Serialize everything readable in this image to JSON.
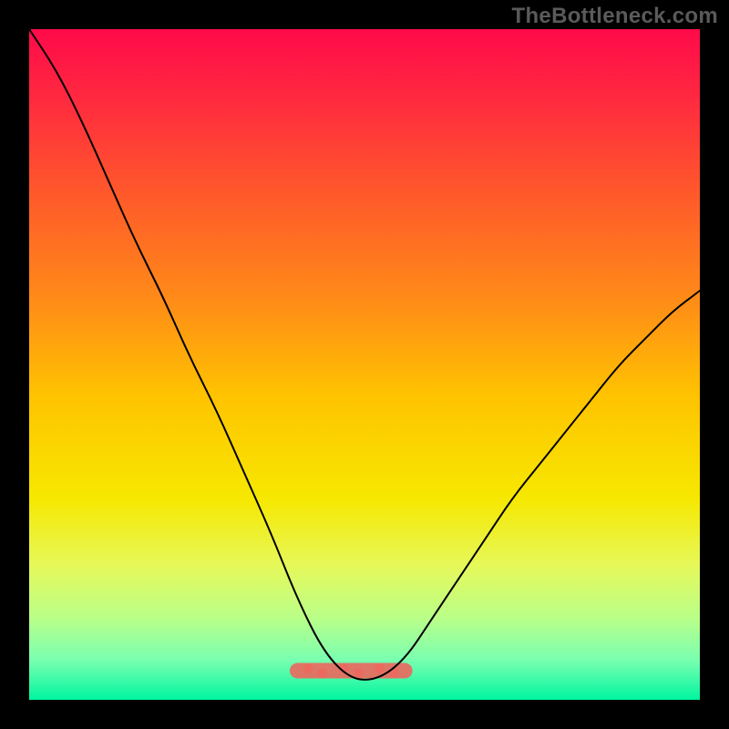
{
  "watermark": "TheBottleneck.com",
  "background": {
    "outer": "#000000",
    "gradient_stops": [
      {
        "offset": 0.0,
        "color": "#ff0a4a"
      },
      {
        "offset": 0.1,
        "color": "#ff2840"
      },
      {
        "offset": 0.25,
        "color": "#ff5a2a"
      },
      {
        "offset": 0.4,
        "color": "#ff8a18"
      },
      {
        "offset": 0.55,
        "color": "#ffc400"
      },
      {
        "offset": 0.7,
        "color": "#f6e800"
      },
      {
        "offset": 0.8,
        "color": "#e6f85a"
      },
      {
        "offset": 0.88,
        "color": "#b8ff8a"
      },
      {
        "offset": 0.94,
        "color": "#7affb0"
      },
      {
        "offset": 1.0,
        "color": "#00f5a0"
      }
    ]
  },
  "accent_band": {
    "color": "#ea6a60",
    "x_start": 0.4,
    "x_end": 0.56,
    "y_top": 0.945,
    "y_bottom": 0.968
  },
  "chart_data": {
    "type": "line",
    "title": "",
    "xlabel": "",
    "ylabel": "",
    "xlim": [
      0,
      1
    ],
    "ylim": [
      0,
      1
    ],
    "series": [
      {
        "name": "curve",
        "x": [
          0.0,
          0.04,
          0.08,
          0.12,
          0.16,
          0.2,
          0.24,
          0.28,
          0.32,
          0.36,
          0.4,
          0.44,
          0.48,
          0.52,
          0.56,
          0.6,
          0.64,
          0.68,
          0.72,
          0.76,
          0.8,
          0.84,
          0.88,
          0.92,
          0.96,
          1.0
        ],
        "y": [
          1.0,
          0.94,
          0.86,
          0.77,
          0.68,
          0.6,
          0.51,
          0.43,
          0.34,
          0.25,
          0.15,
          0.07,
          0.03,
          0.03,
          0.06,
          0.12,
          0.18,
          0.24,
          0.3,
          0.35,
          0.4,
          0.45,
          0.5,
          0.54,
          0.58,
          0.61
        ]
      }
    ],
    "stroke_color": "#000000",
    "stroke_width": 2
  }
}
